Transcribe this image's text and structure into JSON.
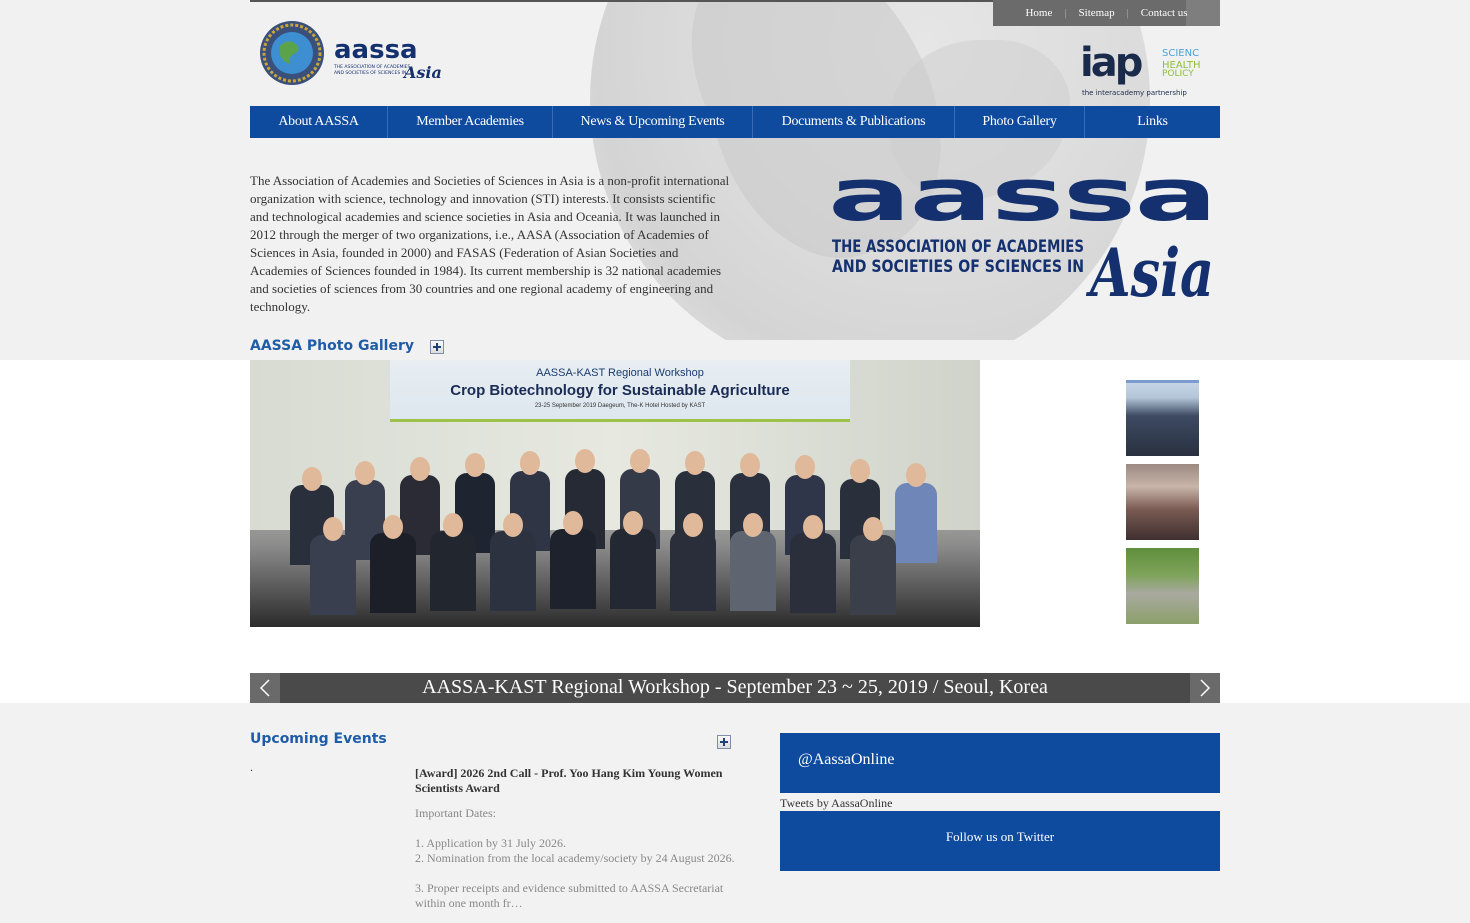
{
  "header": {
    "util_links": [
      "Home",
      "Sitemap",
      "Contact us"
    ],
    "logo_text": "aassa",
    "logo_sub": "THE ASSOCIATION OF ACADEMIES AND SOCIETIES OF SCIENCES IN Asia",
    "iap": {
      "name": "iap",
      "tag1": "SCIENCE",
      "tag2": "HEALTH",
      "tag3": "POLICY",
      "sub": "the interacademy partnership"
    }
  },
  "nav": {
    "items": [
      "About AASSA",
      "Member Academies",
      "News & Upcoming Events",
      "Documents & Publications",
      "Photo Gallery",
      "Links"
    ]
  },
  "intro": {
    "text": "The Association of Academies and Societies of Sciences in Asia is a non-profit international organization with science, technology and innovation (STI) interests. It consists scientific and technological academies and science societies in Asia and Oceania. It was launched in 2012 through the merger of two organizations, i.e., AASA (Association of Academies of Sciences in Asia, founded in 2000) and FASAS (Federation of Asian Societies and Academies of Sciences founded in 1984). Its current membership is 32 national academies and societies of sciences from 30 countries and one regional academy of engineering and technology."
  },
  "big_logo": {
    "word": "aassa",
    "line1": "THE ASSOCIATION OF ACADEMIES",
    "line2": "AND SOCIETIES OF SCIENCES IN",
    "script": "Asia"
  },
  "gallery": {
    "title": "AASSA Photo Gallery",
    "banner_top": "AASSA-KAST Regional Workshop",
    "banner_main": "Crop Biotechnology for Sustainable Agriculture",
    "banner_small": "23-25 September 2019     Daegeum, The-K Hotel     Hosted by KAST",
    "caption": "AASSA-KAST Regional Workshop - September 23 ~ 25, 2019 / Seoul, Korea"
  },
  "events": {
    "title": "Upcoming Events",
    "bullet": ".",
    "item_title": "[Award] 2026 2nd Call - Prof. Yoo Hang Kim Young Women Scientists Award",
    "lines": [
      "Important Dates:",
      "1. Application by 31 July 2026.",
      "2. Nomination from the local academy/society by 24 August 2026.",
      "3. Proper receipts and evidence submitted to AASSA Secretariat within one month fr…"
    ]
  },
  "twitter": {
    "handle": "@AassaOnline",
    "tweets_by": "Tweets by AassaOnline",
    "follow": "Follow us on Twitter"
  },
  "colors": {
    "brand_blue": "#0e4a9e",
    "heading_blue": "#1f5ca8",
    "caption_bar": "#4a4a4a"
  }
}
